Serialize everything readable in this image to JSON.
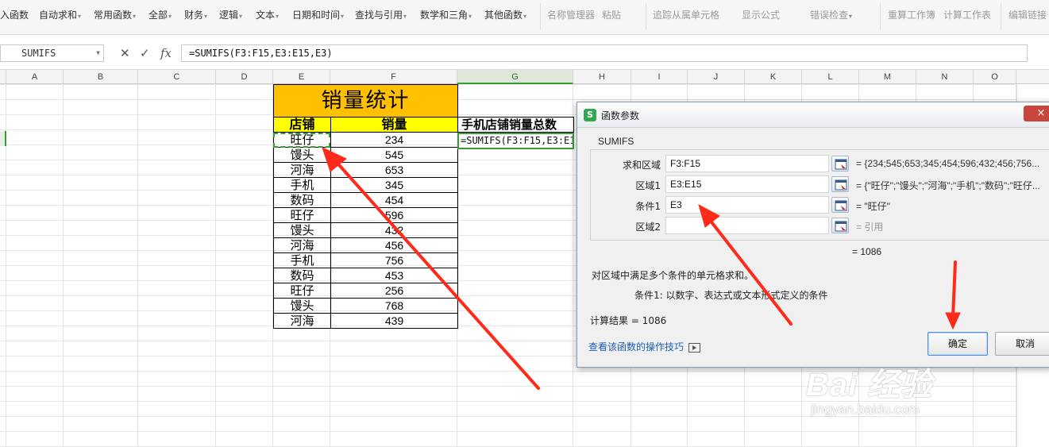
{
  "ribbon": {
    "items": [
      {
        "label": "入函数",
        "dis": false,
        "arrow": false
      },
      {
        "label": "自动求和",
        "dis": false,
        "arrow": true
      },
      {
        "label": "常用函数",
        "dis": false,
        "arrow": true
      },
      {
        "label": "全部",
        "dis": false,
        "arrow": true
      },
      {
        "label": "财务",
        "dis": false,
        "arrow": true
      },
      {
        "label": "逻辑",
        "dis": false,
        "arrow": true
      },
      {
        "label": "文本",
        "dis": false,
        "arrow": true
      },
      {
        "label": "日期和时间",
        "dis": false,
        "arrow": true
      },
      {
        "label": "查找与引用",
        "dis": false,
        "arrow": true
      },
      {
        "label": "数学和三角",
        "dis": false,
        "arrow": true
      },
      {
        "label": "其他函数",
        "dis": false,
        "arrow": true
      },
      {
        "label": "名称管理器",
        "dis": true,
        "arrow": false
      },
      {
        "label": "粘贴",
        "dis": true,
        "arrow": false
      },
      {
        "label": "追踪从属单元格",
        "dis": true,
        "arrow": false
      },
      {
        "label": "显示公式",
        "dis": true,
        "arrow": false
      },
      {
        "label": "错误检查",
        "dis": true,
        "arrow": true
      },
      {
        "label": "重算工作簿",
        "dis": true,
        "arrow": false
      },
      {
        "label": "计算工作表",
        "dis": true,
        "arrow": false
      },
      {
        "label": "编辑链接",
        "dis": true,
        "arrow": false
      }
    ]
  },
  "formula_bar": {
    "name_box": "SUMIFS",
    "cancel_icon": "✕",
    "enter_icon": "✓",
    "fx": "fx",
    "formula": "=SUMIFS(F3:F15,E3:E15,E3)"
  },
  "columns": [
    "A",
    "B",
    "C",
    "D",
    "E",
    "F",
    "G",
    "H",
    "I",
    "J",
    "K",
    "L",
    "M",
    "N",
    "O"
  ],
  "sheet": {
    "title": "销量统计",
    "header_store": "店铺",
    "header_sales": "销量",
    "g_header": "手机店铺销量总数",
    "g_editing": "=SUMIFS(F3:F15,E3:E15,E3)",
    "rows": [
      {
        "store": "旺仔",
        "sales": "234"
      },
      {
        "store": "馒头",
        "sales": "545"
      },
      {
        "store": "河海",
        "sales": "653"
      },
      {
        "store": "手机",
        "sales": "345"
      },
      {
        "store": "数码",
        "sales": "454"
      },
      {
        "store": "旺仔",
        "sales": "596"
      },
      {
        "store": "馒头",
        "sales": "432"
      },
      {
        "store": "河海",
        "sales": "456"
      },
      {
        "store": "手机",
        "sales": "756"
      },
      {
        "store": "数码",
        "sales": "453"
      },
      {
        "store": "旺仔",
        "sales": "256"
      },
      {
        "store": "馒头",
        "sales": "768"
      },
      {
        "store": "河海",
        "sales": "439"
      }
    ]
  },
  "dialog": {
    "title": "函数参数",
    "close": "×",
    "function_name": "SUMIFS",
    "args": [
      {
        "label": "求和区域",
        "value": "F3:F15",
        "result": "= {234;545;653;345;454;596;432;456;756...",
        "dim": false
      },
      {
        "label": "区域1",
        "value": "E3:E15",
        "result": "= {\"旺仔\";\"馒头\";\"河海\";\"手机\";\"数码\";\"旺仔...",
        "dim": false
      },
      {
        "label": "条件1",
        "value": "E3",
        "result": "= \"旺仔\"",
        "dim": false
      },
      {
        "label": "区域2",
        "value": "",
        "result": "= 引用",
        "dim": true
      }
    ],
    "total_result": "= 1086",
    "description": "对区域中满足多个条件的单元格求和。",
    "condition_help": "条件1:   以数字、表达式或文本形式定义的条件",
    "calc_result": "计算结果 =  1086",
    "help_link": "查看该函数的操作技巧",
    "ok": "确定",
    "cancel": "取消"
  },
  "watermark": {
    "main": "Bai 经验",
    "sub": "jingyan.baidu.com"
  },
  "colors": {
    "title_fill": "#ffc000",
    "header_fill": "#ffff00",
    "selection_green": "#3c9a3c",
    "arrow_red": "#ff2a1a"
  }
}
